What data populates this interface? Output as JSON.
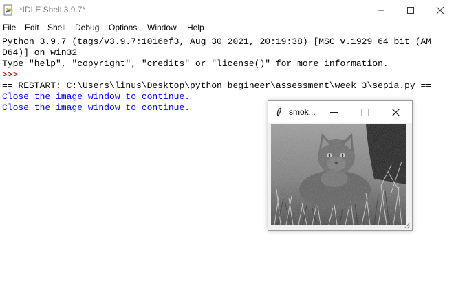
{
  "window": {
    "title": "*IDLE Shell 3.9.7*"
  },
  "menu": [
    "File",
    "Edit",
    "Shell",
    "Debug",
    "Options",
    "Window",
    "Help"
  ],
  "shell_lines": [
    {
      "text": "Python 3.9.7 (tags/v3.9.7:1016ef3, Aug 30 2021, 20:19:38) [MSC v.1929 64 bit (AM",
      "style": "out"
    },
    {
      "text": "D64)] on win32",
      "style": "out"
    },
    {
      "text": "Type \"help\", \"copyright\", \"credits\" or \"license()\" for more information.",
      "style": "out"
    },
    {
      "text": ">>> ",
      "style": "prompt"
    },
    {
      "text": "== RESTART: C:\\Users\\linus\\Desktop\\python begineer\\assessment\\week 3\\sepia.py ==",
      "style": "out"
    },
    {
      "text": "Close the image window to continue.",
      "style": "blue"
    },
    {
      "text": "Close the image window to continue.",
      "style": "blue"
    }
  ],
  "image_window": {
    "title": "smok...",
    "icon": "feather-icon",
    "image_description_name": "cat-photo"
  },
  "colors": {
    "prompt": "#c00000",
    "program_output": "#0000ff",
    "text": "#000000"
  }
}
